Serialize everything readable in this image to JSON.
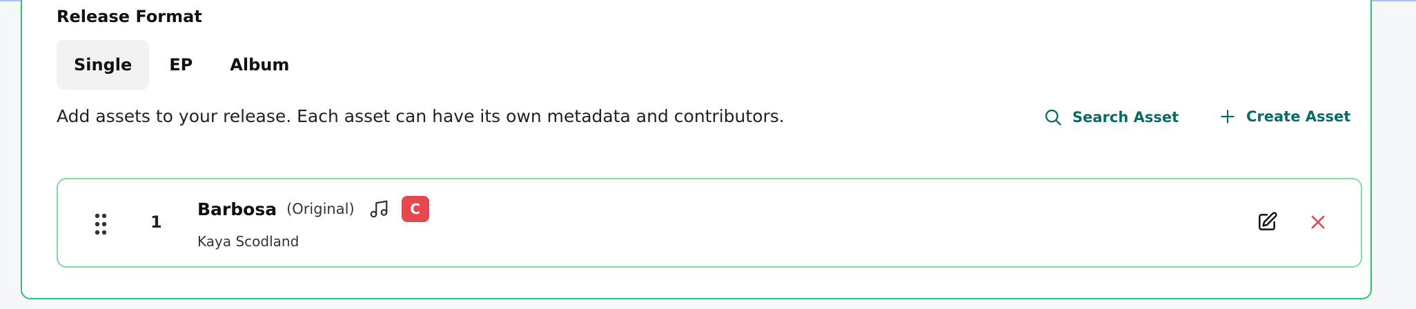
{
  "release_format": {
    "title": "Release Format",
    "options": [
      {
        "label": "Single",
        "selected": true
      },
      {
        "label": "EP",
        "selected": false
      },
      {
        "label": "Album",
        "selected": false
      }
    ]
  },
  "assets": {
    "helper_text": "Add assets to your release. Each asset can have its own metadata and contributors.",
    "search_label": "Search Asset",
    "create_label": "Create Asset",
    "rows": [
      {
        "index": "1",
        "title": "Barbosa",
        "version": "(Original)",
        "badge": "C",
        "artist": "Kaya Scodland"
      }
    ]
  },
  "icons": {
    "search": "search-icon",
    "create": "plus-icon",
    "drag": "drag-handle-icon",
    "music": "music-note-icon",
    "edit": "edit-icon",
    "remove": "close-icon"
  },
  "colors": {
    "accent": "#0b6a62",
    "card_border": "#2cc46b",
    "row_border": "#7ddf9e",
    "badge": "#e5484d",
    "remove": "#e5484d",
    "selected_bg": "#f2f2f2"
  }
}
